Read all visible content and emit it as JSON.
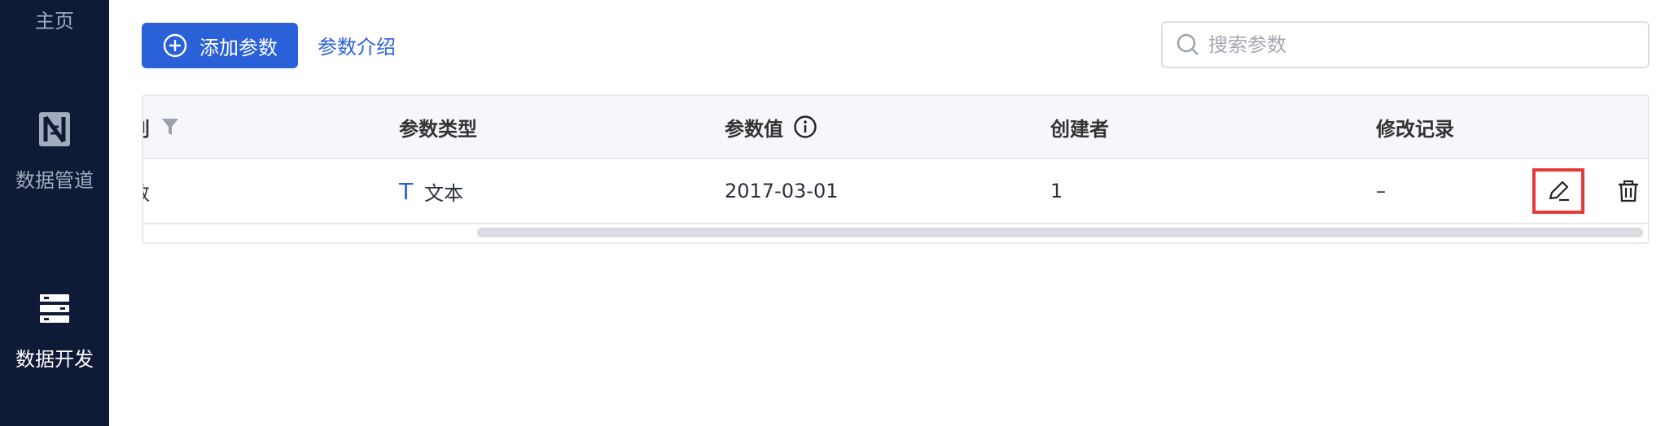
{
  "sidebar": {
    "items": [
      {
        "label": "主页",
        "icon": "home-icon"
      },
      {
        "label": "数据管道",
        "icon": "pipeline-icon"
      },
      {
        "label": "数据开发",
        "icon": "data-dev-icon",
        "active": true
      }
    ]
  },
  "toolbar": {
    "add_label": "添加参数",
    "intro_label": "参数介绍",
    "search_placeholder": "搜索参数"
  },
  "table": {
    "columns": [
      "别",
      "参数类型",
      "参数值",
      "创建者",
      "修改记录"
    ],
    "rows": [
      {
        "name_fragment": "数",
        "type_label": "文本",
        "type_icon": "T",
        "value": "2017-03-01",
        "creator": "1",
        "history": "–"
      }
    ]
  },
  "colors": {
    "sidebar_bg": "#0e1a36",
    "primary": "#2b61d8",
    "highlight": "#e53935"
  }
}
